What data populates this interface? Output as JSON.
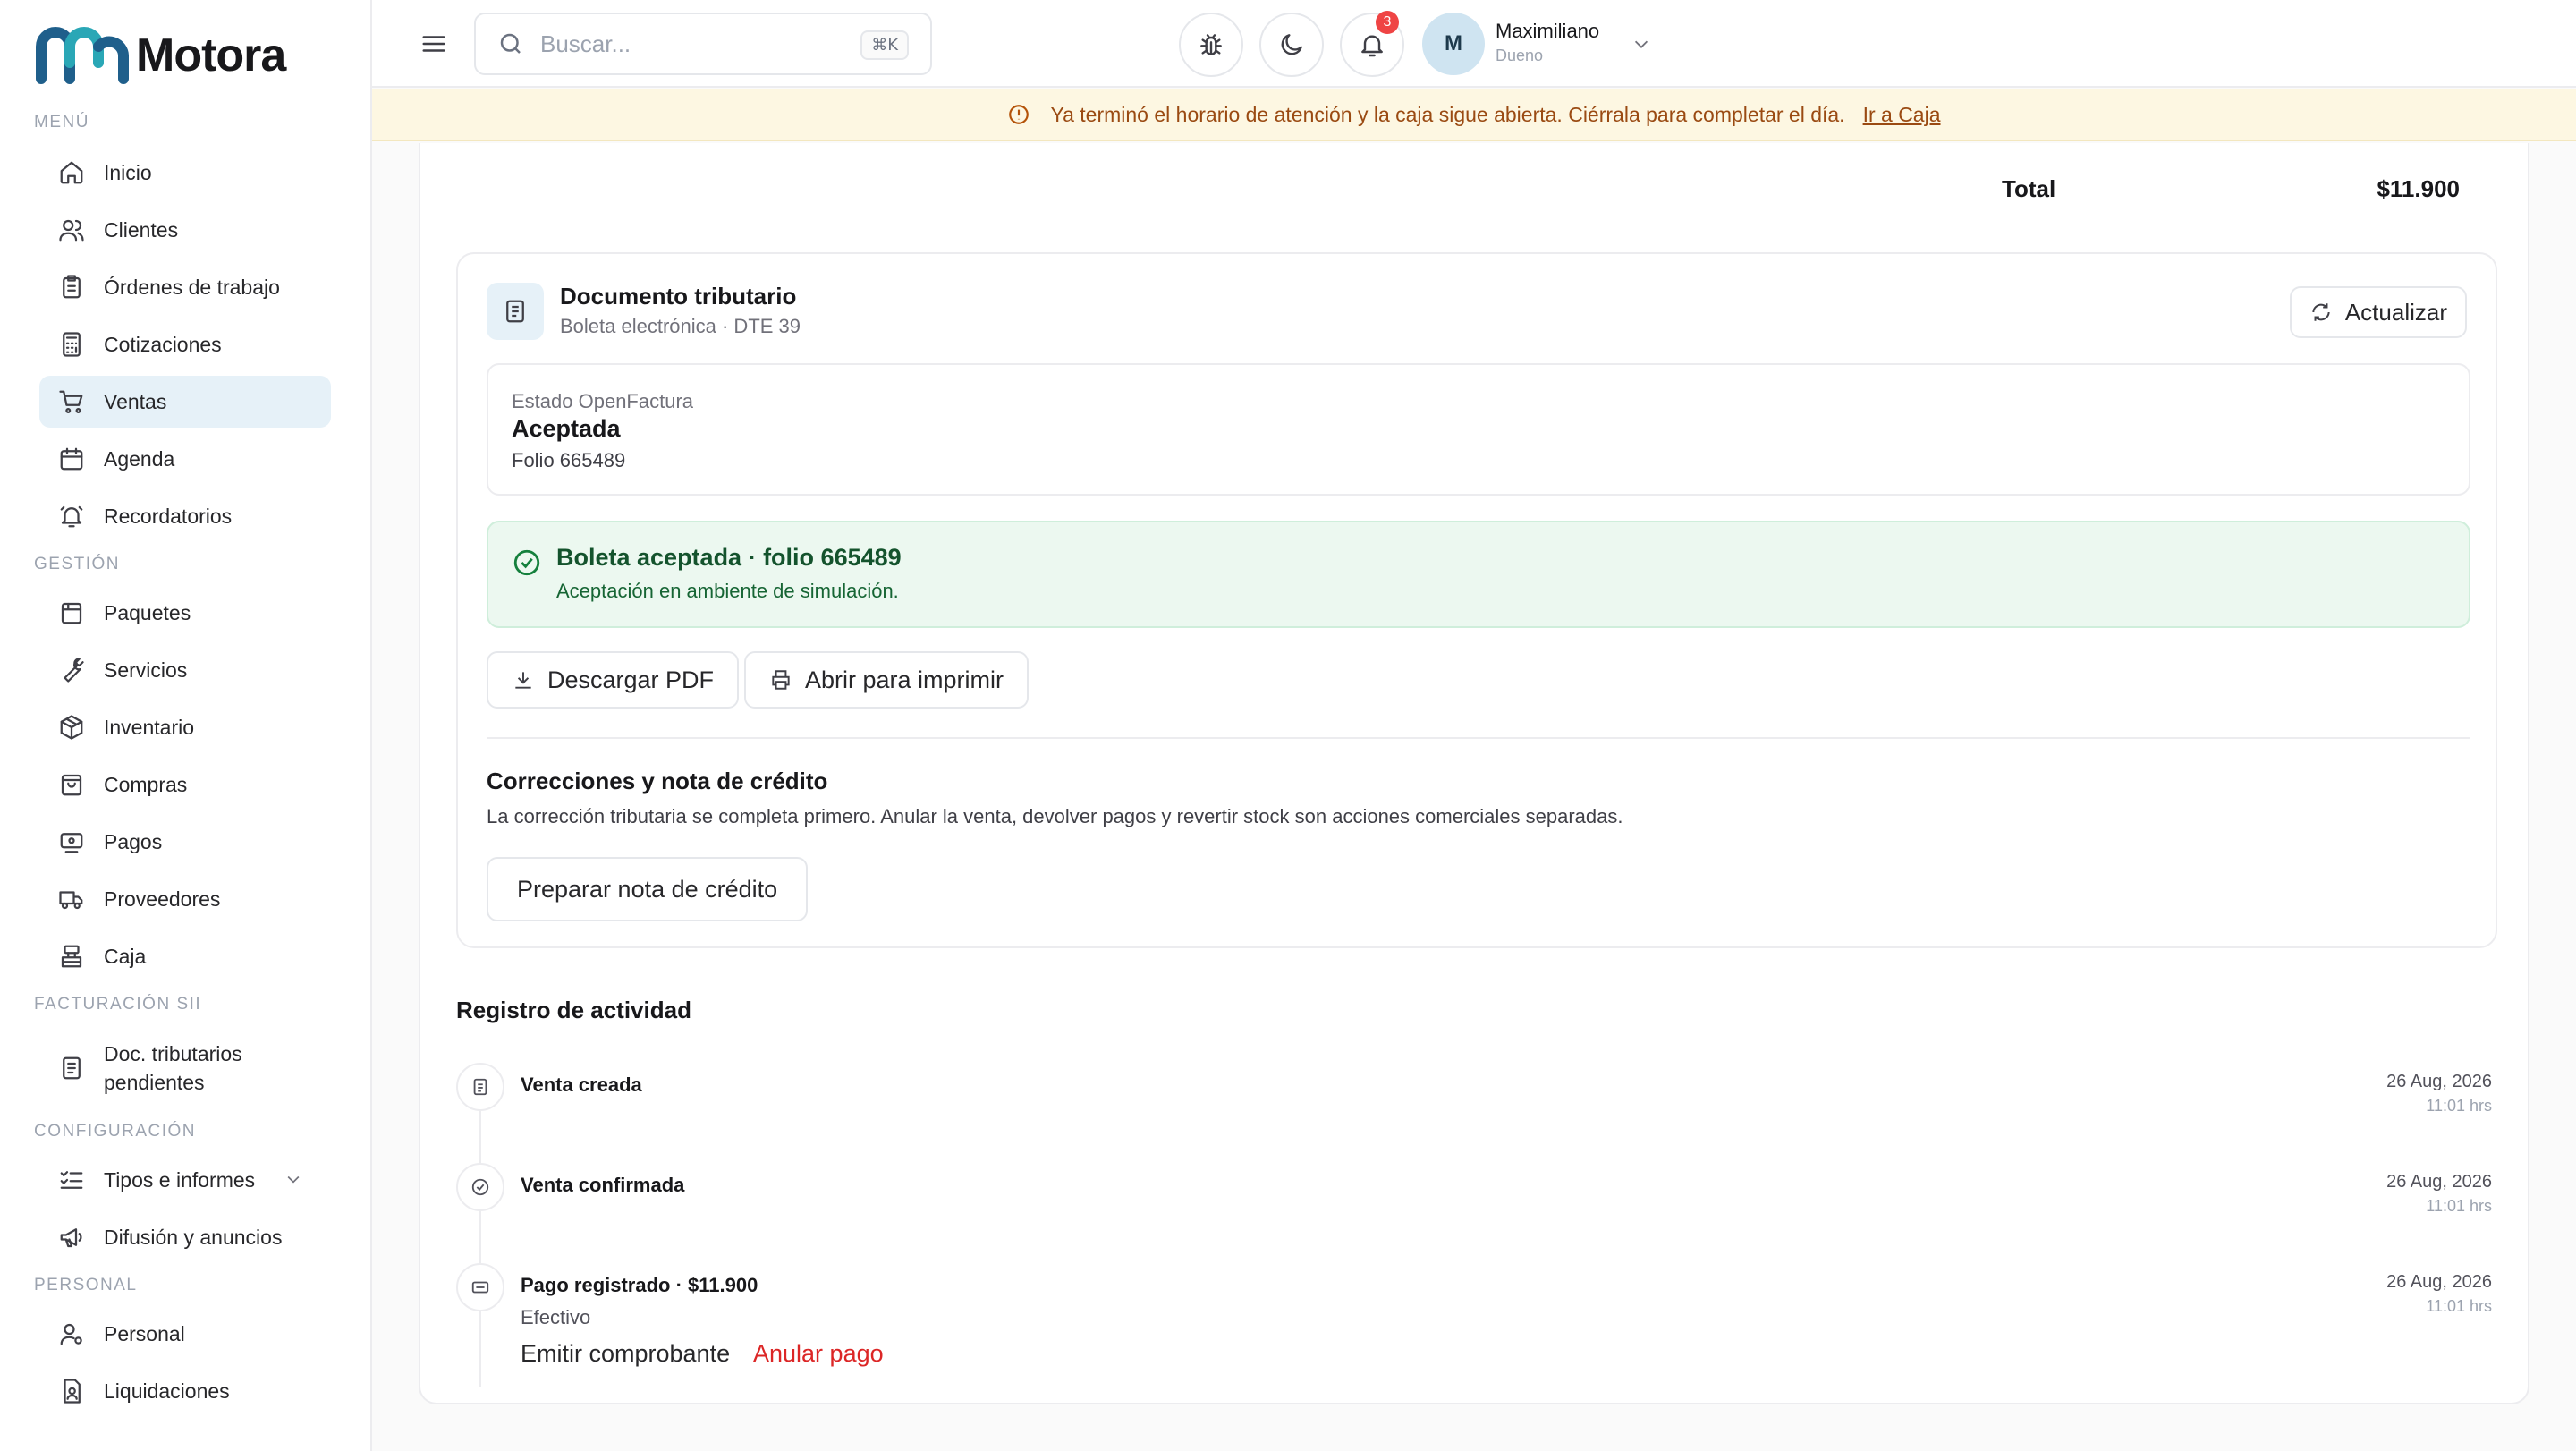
{
  "brand": {
    "name": "Motora",
    "accent": "#1f5f8b"
  },
  "sidebar": {
    "sections": {
      "menu": "MENÚ",
      "gestion": "GESTIÓN",
      "facturacion": "FACTURACIÓN SII",
      "configuracion": "CONFIGURACIÓN",
      "personal": "PERSONAL"
    },
    "items": [
      {
        "label": "Inicio",
        "icon": "home-icon"
      },
      {
        "label": "Clientes",
        "icon": "users-icon"
      },
      {
        "label": "Órdenes de trabajo",
        "icon": "clipboard-icon"
      },
      {
        "label": "Cotizaciones",
        "icon": "calculator-icon"
      },
      {
        "label": "Ventas",
        "icon": "cart-icon",
        "active": true
      },
      {
        "label": "Agenda",
        "icon": "calendar-icon"
      },
      {
        "label": "Recordatorios",
        "icon": "bell-icon"
      },
      {
        "label": "Paquetes",
        "icon": "package-icon"
      },
      {
        "label": "Servicios",
        "icon": "wrench-icon"
      },
      {
        "label": "Inventario",
        "icon": "boxes-icon"
      },
      {
        "label": "Compras",
        "icon": "bag-icon"
      },
      {
        "label": "Pagos",
        "icon": "payments-icon"
      },
      {
        "label": "Proveedores",
        "icon": "truck-icon"
      },
      {
        "label": "Caja",
        "icon": "register-icon"
      },
      {
        "label": "Doc. tributarios pendientes",
        "icon": "document-icon"
      },
      {
        "label": "Tipos e informes",
        "icon": "list-check-icon"
      },
      {
        "label": "Difusión y anuncios",
        "icon": "megaphone-icon"
      },
      {
        "label": "Personal",
        "icon": "user-cog-icon"
      },
      {
        "label": "Liquidaciones",
        "icon": "file-user-icon"
      }
    ]
  },
  "topbar": {
    "search_placeholder": "Buscar...",
    "search_shortcut": "⌘K",
    "notifications_count": "3",
    "user": {
      "initial": "M",
      "name": "Maximiliano",
      "role": "Dueno"
    }
  },
  "banner": {
    "message": "Ya terminó el horario de atención y la caja sigue abierta. Ciérrala para completar el día.",
    "link": "Ir a Caja"
  },
  "summary": {
    "total_label": "Total",
    "total_value": "$11.900"
  },
  "document": {
    "title": "Documento tributario",
    "subtitle": "Boleta electrónica · DTE 39",
    "update_button": "Actualizar",
    "state_label": "Estado OpenFactura",
    "state_value": "Aceptada",
    "folio": "Folio 665489",
    "success_title": "Boleta aceptada · folio 665489",
    "success_sub": "Aceptación en ambiente de simulación.",
    "download_button": "Descargar PDF",
    "print_button": "Abrir para imprimir",
    "corrections_title": "Correcciones y nota de crédito",
    "corrections_text": "La corrección tributaria se completa primero. Anular la venta, devolver pagos y revertir stock son acciones comerciales separadas.",
    "credit_note_button": "Preparar nota de crédito"
  },
  "activity": {
    "title": "Registro de actividad",
    "items": [
      {
        "title": "Venta creada",
        "date": "26 Aug, 2026",
        "time": "11:01 hrs"
      },
      {
        "title": "Venta confirmada",
        "date": "26 Aug, 2026",
        "time": "11:01 hrs"
      },
      {
        "title": "Pago registrado · $11.900",
        "sub": "Efectivo",
        "date": "26 Aug, 2026",
        "time": "11:01 hrs"
      }
    ],
    "emit_receipt": "Emitir comprobante",
    "void_payment": "Anular pago"
  }
}
